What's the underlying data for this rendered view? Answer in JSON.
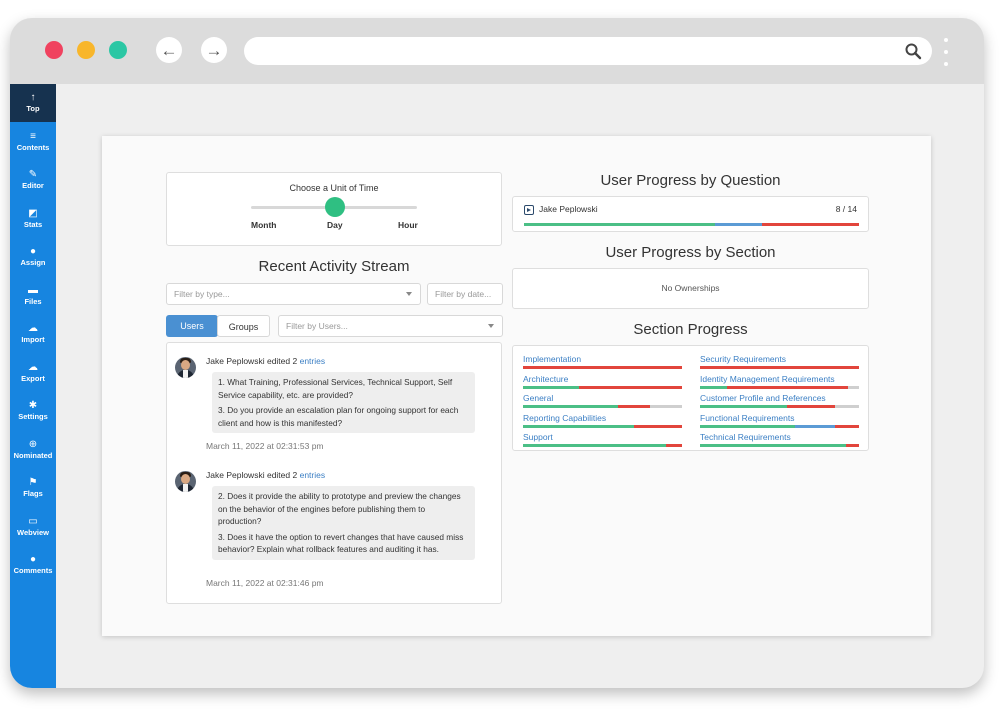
{
  "browser": {
    "traffic_lights": [
      "close",
      "minimize",
      "zoom"
    ],
    "back_icon": "←",
    "forward_icon": "→"
  },
  "sidebar": {
    "items": [
      {
        "label": "Top",
        "icon": "↑",
        "active": true
      },
      {
        "label": "Contents",
        "icon": "≡"
      },
      {
        "label": "Editor",
        "icon": "✎"
      },
      {
        "label": "Stats",
        "icon": "◩"
      },
      {
        "label": "Assign",
        "icon": "●"
      },
      {
        "label": "Files",
        "icon": "▬"
      },
      {
        "label": "Import",
        "icon": "☁"
      },
      {
        "label": "Export",
        "icon": "☁"
      },
      {
        "label": "Settings",
        "icon": "✱"
      },
      {
        "label": "Nominated",
        "icon": "⊕"
      },
      {
        "label": "Flags",
        "icon": "⚑"
      },
      {
        "label": "Webview",
        "icon": "▭"
      },
      {
        "label": "Comments",
        "icon": "●"
      }
    ]
  },
  "time_unit": {
    "title": "Choose a Unit of Time",
    "options": [
      "Month",
      "Day",
      "Hour"
    ],
    "selected": "Day"
  },
  "activity": {
    "title": "Recent Activity Stream",
    "filter_type_placeholder": "Filter by type...",
    "filter_date_placeholder": "Filter by date...",
    "tab_users": "Users",
    "tab_groups": "Groups",
    "filter_users_placeholder": "Filter by Users...",
    "items": [
      {
        "user": "Jake Peplowski",
        "action": "edited 2",
        "link": "entries",
        "lines": [
          "1. What Training, Professional Services, Technical Support, Self Service capability, etc. are provided?",
          "3. Do you provide an escalation plan for ongoing support for each client and how is this manifested?"
        ],
        "time": "March 11, 2022 at 02:31:53 pm"
      },
      {
        "user": "Jake Peplowski",
        "action": "edited 2",
        "link": "entries",
        "lines": [
          "2. Does it provide the ability to prototype and preview the changes on the behavior of the engines before publishing them to production?",
          "3. Does it have the option to revert changes that have caused miss behavior? Explain what rollback features and auditing it has."
        ],
        "time": "March 11, 2022 at 02:31:46 pm"
      }
    ]
  },
  "user_progress_question": {
    "title": "User Progress by Question",
    "user": "Jake Peplowski",
    "count": "8 / 14",
    "segments": [
      0.57,
      0.14,
      0.29
    ]
  },
  "user_progress_section": {
    "title": "User Progress by Section",
    "empty": "No Ownerships"
  },
  "section_progress": {
    "title": "Section Progress",
    "items": [
      {
        "name": "Implementation",
        "segments": [
          0,
          0,
          1.0,
          0
        ]
      },
      {
        "name": "Security Requirements",
        "segments": [
          0,
          0,
          1.0,
          0
        ]
      },
      {
        "name": "Architecture",
        "segments": [
          0.35,
          0.0,
          0.65,
          0
        ]
      },
      {
        "name": "Identity Management Requirements",
        "segments": [
          0.17,
          0,
          0.76,
          0.07
        ]
      },
      {
        "name": "General",
        "segments": [
          0.6,
          0,
          0.2,
          0.2
        ]
      },
      {
        "name": "Customer Profile and References",
        "segments": [
          0.55,
          0,
          0.3,
          0.15
        ]
      },
      {
        "name": "Reporting Capabilities",
        "segments": [
          0.7,
          0,
          0.3,
          0
        ]
      },
      {
        "name": "Functional Requirements",
        "segments": [
          0.6,
          0.25,
          0.15,
          0
        ]
      },
      {
        "name": "Support",
        "segments": [
          0.9,
          0,
          0.1,
          0
        ]
      },
      {
        "name": "Technical Requirements",
        "segments": [
          0.92,
          0,
          0.08,
          0
        ]
      }
    ]
  },
  "colors": {
    "sidebar": "#1785e0",
    "sidebar_active": "#16324f",
    "accent": "#4a90d2",
    "link": "#3b7fc4",
    "progress_green": "#4bbf86",
    "progress_blue": "#5b9bd5",
    "progress_red": "#e2453c",
    "progress_gray": "#cfcfcf",
    "slider_thumb": "#2fbf82"
  }
}
